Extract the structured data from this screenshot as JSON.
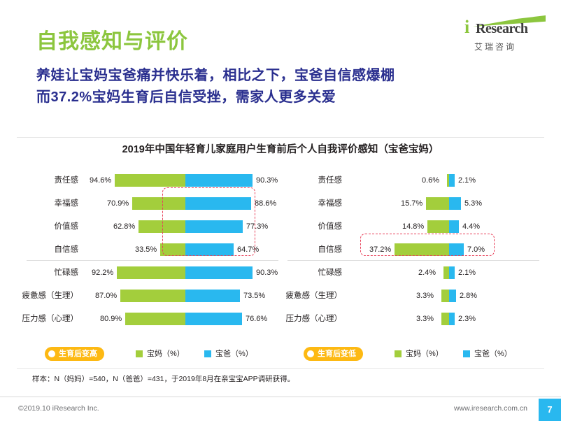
{
  "header": {
    "title": "自我感知与评价",
    "subtitle_line1": "养娃让宝妈宝爸痛并快乐着，相比之下，宝爸自信感爆棚",
    "subtitle_line2": "而37.2%宝妈生育后自信受挫，需家人更多关爱",
    "logo_i": "i",
    "logo_research": "Research",
    "logo_cn": "艾瑞咨询"
  },
  "chart_data": {
    "type": "bar",
    "title": "2019年中国年轻育儿家庭用户生育前后个人自我评价感知（宝爸宝妈）",
    "xlabel": "",
    "ylabel": "",
    "orientation": "horizontal",
    "panels": [
      {
        "name": "生育后变高",
        "categories": [
          "责任感",
          "幸福感",
          "价值感",
          "自信感",
          "忙碌感",
          "疲惫感（生理）",
          "压力感（心理）"
        ],
        "series": [
          {
            "name": "宝妈（%）",
            "color": "#a3ce3c",
            "values": [
              94.6,
              70.9,
              62.8,
              33.5,
              92.2,
              87.0,
              73.5
            ]
          },
          {
            "name": "宝爸（%）",
            "color": "#29b8ef",
            "values": [
              90.3,
              88.6,
              77.3,
              64.7,
              90.3,
              73.5,
              76.6
            ]
          }
        ],
        "labels_left": [
          "94.6%",
          "70.9%",
          "62.8%",
          "33.5%",
          "92.2%",
          "87.0%",
          "80.9%"
        ],
        "labels_right": [
          "90.3%",
          "88.6%",
          "77.3%",
          "64.7%",
          "90.3%",
          "73.5%",
          "76.6%"
        ],
        "highlight_rows": [
          1,
          2,
          3
        ]
      },
      {
        "name": "生育后变低",
        "categories": [
          "责任感",
          "幸福感",
          "价值感",
          "自信感",
          "忙碌感",
          "疲惫感（生理）",
          "压力感（心理）"
        ],
        "series": [
          {
            "name": "宝妈（%）",
            "color": "#a3ce3c",
            "values": [
              0.6,
              15.7,
              14.8,
              37.2,
              2.4,
              3.3,
              3.3
            ]
          },
          {
            "name": "宝爸（%）",
            "color": "#29b8ef",
            "values": [
              2.1,
              5.3,
              4.4,
              7.0,
              2.1,
              2.8,
              2.3
            ]
          }
        ],
        "labels_left": [
          "0.6%",
          "15.7%",
          "14.8%",
          "37.2%",
          "2.4%",
          "3.3%",
          "3.3%"
        ],
        "labels_right": [
          "2.1%",
          "5.3%",
          "4.4%",
          "7.0%",
          "2.1%",
          "2.8%",
          "2.3%"
        ],
        "highlight_rows": [
          3
        ]
      }
    ],
    "legend": {
      "left_pill": "生育后变高",
      "right_pill": "生育后变低",
      "mom_label": "宝妈（%）",
      "dad_label": "宝爸（%）",
      "mom_color": "#a3ce3c",
      "dad_color": "#29b8ef"
    },
    "note": "样本：N（妈妈）=540，N（爸爸）=431，于2019年8月在亲宝宝APP调研获得。"
  },
  "footer": {
    "copyright": "©2019.10 iResearch Inc.",
    "site": "www.iresearch.com.cn",
    "page": "7"
  }
}
